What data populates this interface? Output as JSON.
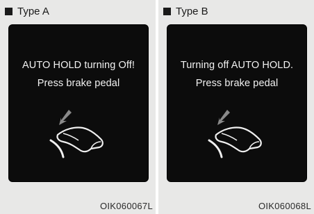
{
  "panels": [
    {
      "header": "Type A",
      "line1": "AUTO HOLD turning Off!",
      "line2": "Press brake pedal",
      "code": "OIK060067L"
    },
    {
      "header": "Type B",
      "line1": "Turning off AUTO HOLD.",
      "line2": "Press brake pedal",
      "code": "OIK060068L"
    }
  ],
  "icons": [
    "square-bullet-icon",
    "brake-pedal-icon"
  ],
  "colors": {
    "panel_bg": "#e8e8e7",
    "screen_bg": "#0c0c0c",
    "display_text": "#f2f2f2"
  }
}
